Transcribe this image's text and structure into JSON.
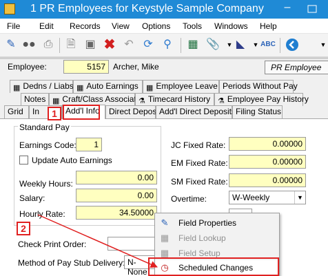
{
  "window": {
    "title": "1 PR Employees for Keystyle Sample Company",
    "minimize_glyph": "–"
  },
  "menu": [
    "File",
    "Edit",
    "Records",
    "View",
    "Options",
    "Tools",
    "Windows",
    "Help"
  ],
  "toolbar_icons": [
    "edit-record-icon",
    "binoculars-icon",
    "printer-icon",
    "new-document-icon",
    "save-icon",
    "delete-icon",
    "undo-icon",
    "refresh-icon",
    "search-icon",
    "calculator-icon",
    "attachment-icon",
    "scanner-icon",
    "spell-check-icon",
    "back-icon"
  ],
  "employee": {
    "label": "Employee:",
    "id": "5157",
    "name": "Archer, Mike",
    "pr_button": "PR Employee"
  },
  "tabs": {
    "row1": [
      "Dedns / Liabs",
      "Auto Earnings",
      "Employee Leave",
      "Periods Without Pay"
    ],
    "row2": [
      "Notes",
      "Craft/Class Association",
      "Timecard History",
      "Employee Pay History"
    ],
    "row3": [
      "Grid",
      "In",
      "Add'l Info",
      "Direct Deposit",
      "Add'l Direct Deposits",
      "Filing Status"
    ]
  },
  "form": {
    "standard_pay": "Standard Pay",
    "earnings_code_label": "Earnings Code:",
    "earnings_code": "1",
    "update_auto_label": "Update Auto Earnings",
    "weekly_hours_label": "Weekly Hours:",
    "weekly_hours": "0.00",
    "salary_label": "Salary:",
    "salary": "0.00",
    "hourly_rate_label": "Hourly Rate:",
    "hourly_rate": "34.50000",
    "jc_label": "JC Fixed Rate:",
    "jc_value": "0.00000",
    "em_label": "EM Fixed Rate:",
    "em_value": "0.00000",
    "sm_label": "SM Fixed Rate:",
    "sm_value": "0.00000",
    "overtime_label": "Overtime:",
    "overtime_value": "W-Weekly",
    "check_print_label": "Check Print Order:",
    "method_label": "Method of Pay Stub Delivery:",
    "method_value": "N-None"
  },
  "context_menu": [
    {
      "label": "Field Properties",
      "disabled": false
    },
    {
      "label": "Field Lookup",
      "disabled": true
    },
    {
      "label": "Field Setup",
      "disabled": true
    },
    {
      "label": "Scheduled Changes",
      "disabled": false
    }
  ],
  "annotations": {
    "marker1": "1",
    "marker2": "2",
    "color": "#e02020"
  },
  "colors": {
    "titlebar": "#1f8ad6",
    "field_yellow": "#ffffc0"
  }
}
